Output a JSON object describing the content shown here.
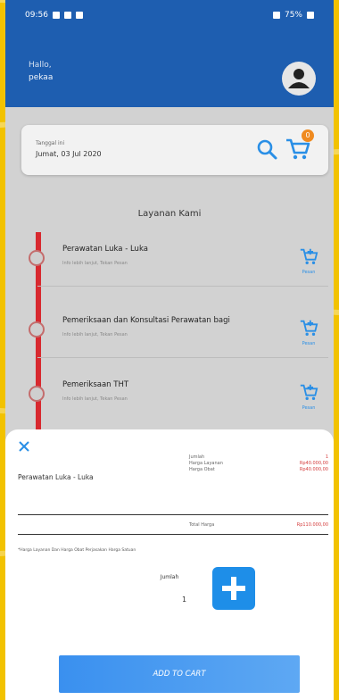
{
  "status_bar": {
    "time": "09:56",
    "right_text": "75%"
  },
  "header": {
    "greeting": "Hallo,",
    "user_name": "pekaa"
  },
  "date_card": {
    "label": "Tanggal ini",
    "value": "Jumat, 03 Jul 2020",
    "cart_count": "0"
  },
  "section": {
    "title": "Layanan Kami"
  },
  "services": [
    {
      "name": "Perawatan Luka - Luka",
      "subtitle": "Info lebih lanjut, Tekan Pesan",
      "action": "Pesan"
    },
    {
      "name": "Pemeriksaan dan Konsultasi Perawatan bagi",
      "subtitle": "Info lebih lanjut, Tekan Pesan",
      "action": "Pesan"
    },
    {
      "name": "Pemeriksaan THT",
      "subtitle": "Info lebih lanjut, Tekan Pesan",
      "action": "Pesan"
    }
  ],
  "sheet": {
    "service_name": "Perawatan Luka - Luka",
    "details": [
      {
        "label": "Jumlah",
        "value": "1"
      },
      {
        "label": "Harga Layanan",
        "value": "Rp40.000,00"
      },
      {
        "label": "Harga Obat",
        "value": "Rp40.000,00"
      }
    ],
    "total_label": "Total Harga",
    "total_value": "Rp110.000,00",
    "note": "*Harga Layanan Dan Harga Obat Perjasakan Harga Satuan",
    "quantity_label": "Jumlah",
    "quantity": "1",
    "add_to_cart_label": "ADD TO CART"
  },
  "colors": {
    "primary": "#1e5eb0",
    "accent": "#1e8ee8",
    "price": "#d43c3c",
    "timeline": "#d8292f"
  }
}
